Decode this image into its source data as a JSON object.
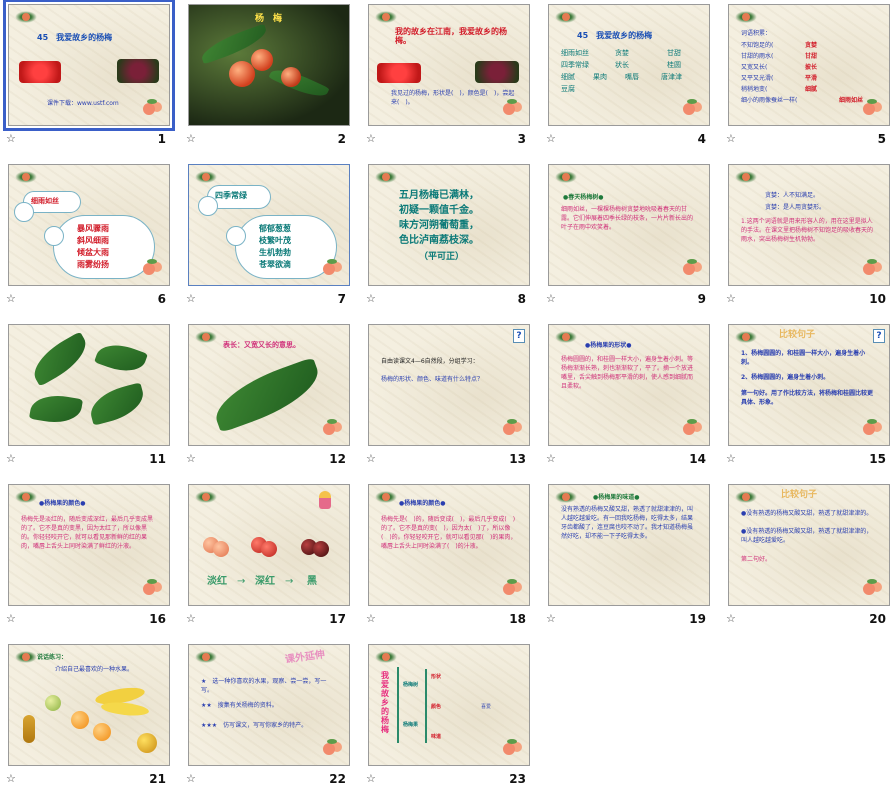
{
  "sorter": {
    "slides": [
      {
        "num": "1",
        "title": "45　我爱故乡的杨梅",
        "footer": "课件下载：www.ustf.com"
      },
      {
        "num": "2",
        "title": "杨　梅"
      },
      {
        "num": "3",
        "title": "我的故乡在江南，我爱故乡的杨梅。",
        "body": "我见过的杨梅，形状是(　)，颜色是(　)，尝起来(　)。"
      },
      {
        "num": "4",
        "title": "45　我爱故乡的杨梅",
        "words": [
          "细雨如丝",
          "贪婪",
          "甘甜",
          "四季常绿",
          "状长",
          "桂圆",
          "细腻",
          "果肉",
          "嘴唇",
          "唐津津",
          "豆腐"
        ]
      },
      {
        "num": "5",
        "heading": "词语积累：",
        "lines": [
          "不知饱足的(",
          "甘甜的雨水(",
          "又宽又长(",
          "又平又光滑(",
          "稍稍地变(",
          "细小的雨像蚕丝一样("
        ],
        "answers": [
          "贪婪",
          "甘甜",
          "披长",
          "平滑",
          "细腻",
          "细雨如丝"
        ]
      },
      {
        "num": "6",
        "heading": "细雨如丝",
        "items": [
          "暴风骤雨",
          "斜风细雨",
          "倾盆大雨",
          "雨雾纷扬"
        ]
      },
      {
        "num": "7",
        "heading": "四季常绿",
        "items": [
          "郁郁葱葱",
          "枝繁叶茂",
          "生机勃勃",
          "苍翠欲滴"
        ]
      },
      {
        "num": "8",
        "poem": [
          "五月杨梅已满林，",
          "初疑一颗值千金。",
          "味方河朔葡萄重，",
          "色比泸南荔枝深。"
        ],
        "author": "（平可正）"
      },
      {
        "num": "9",
        "heading": "●春天杨梅树●",
        "body": "细雨如丝，一棵棵杨梅树贪婪地吮吸着春天的甘露。它们伸展着四季长绿的枝条，一片片新长出的叶子在雨中欢笑着。"
      },
      {
        "num": "10",
        "lines": [
          "贪婪：人不知满足。",
          "贪婪：是人用贪婪形。"
        ],
        "body": "1.这两个词语就是用来形容人的，用在这里是拟人的手法。在课文里把杨梅树不知饱足的吸收春天的雨水，突出杨梅树生机勃勃。"
      },
      {
        "num": "11"
      },
      {
        "num": "12",
        "heading": "表长：又宽又长的意思。"
      },
      {
        "num": "13",
        "line1": "自由读课文4—6自然段，分组学习：",
        "line2": "杨梅的形状、颜色、味道有什么特点？"
      },
      {
        "num": "14",
        "heading": "●杨梅果的形状●",
        "body": "杨梅圆圆的，和桂圆一样大小，遍身生着小刺。等杨梅渐渐长熟，刺也渐渐软了，平了。摘一个放进嘴里，舌尖触到杨梅那平滑的刺，使人感到细腻而且柔软。"
      },
      {
        "num": "15",
        "heading": "比较句子",
        "items": [
          "1、杨梅圆圆的，和桂圆一样大小，遍身生着小刺。",
          "2、杨梅圆圆的，遍身生着小刺。"
        ],
        "body": "第一句好。用了作比较方法，将杨梅和桂圆比较更具体、形象。"
      },
      {
        "num": "16",
        "heading": "●杨梅果的颜色●",
        "body": "杨梅先是淡红的，随后变成深红，最后几乎变成黑的了。它不是真的变黑，因为太红了，所以像黑的。你轻轻咬开它，就可以看见那新鲜的红的果肉，嘴唇上舌头上同时染满了鲜红的汁液。"
      },
      {
        "num": "17",
        "labels": [
          "淡红",
          "深红",
          "黑"
        ]
      },
      {
        "num": "18",
        "heading": "●杨梅果的颜色●",
        "body": "杨梅先是(　)的，随后变成(　)，最后几乎变成(　)的了。它不是真的变(　)，因为太(　)了，所以像(　)的。你轻轻咬开它，就可以看见那(　)的果肉，嘴唇上舌头上同时染满了(　)的汁液。"
      },
      {
        "num": "19",
        "heading": "●杨梅果的味道●",
        "body": "没有熟透的杨梅又酸又甜，熟透了就甜津津的，叫人越吃越爱吃。有一回我吃杨梅，吃得太多，结果牙齿都酸了，连豆腐也咬不动了。我才知道杨梅虽然好吃，却不能一下子吃得太多。"
      },
      {
        "num": "20",
        "heading": "比较句子",
        "items": [
          "●没有熟透的杨梅又酸又甜，熟透了就甜津津的。",
          "●没有熟透的杨梅又酸又甜，熟透了就甜津津的，叫人越吃越爱吃。"
        ],
        "note": "第二句好。"
      },
      {
        "num": "21",
        "heading": "说话练习：",
        "body": "介绍自己最喜欢的一种水果。"
      },
      {
        "num": "22",
        "heading": "课外延伸",
        "items": [
          "★　选一种你喜欢的水果，观察、尝一尝，写一写。",
          "★★　搜集有关杨梅的资料。",
          "★★★　仿写课文，写写你家乡的特产。"
        ]
      },
      {
        "num": "23",
        "heading": "我爱故乡的杨梅",
        "nodes": [
          "杨梅树",
          "杨梅果",
          "形状",
          "颜色",
          "味道",
          "喜爱"
        ]
      }
    ]
  },
  "colors": {
    "selection": "#3a5fc8",
    "slide_bg": "#f4efe0"
  },
  "icons": {
    "slide_marker": "star-icon"
  }
}
